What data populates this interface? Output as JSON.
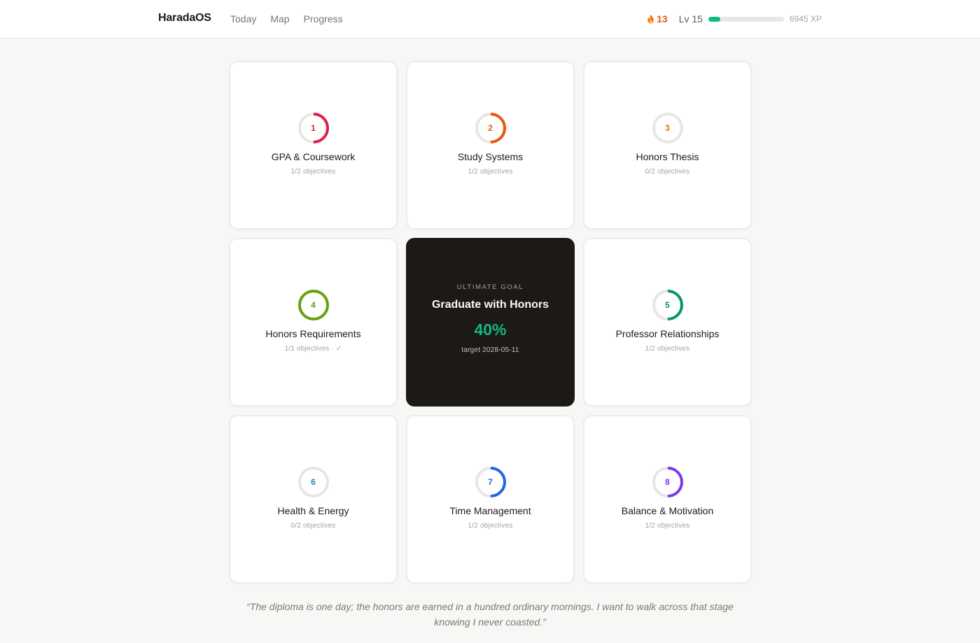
{
  "app": {
    "name": "HaradaOS"
  },
  "nav": [
    {
      "label": "Today"
    },
    {
      "label": "Map"
    },
    {
      "label": "Progress"
    }
  ],
  "stats": {
    "streak": "13",
    "level": "Lv 15",
    "xp_label": "6945 XP",
    "xp_progress": 0.16,
    "streak_color": "#ea580c",
    "xp_color": "#10b981"
  },
  "goal": {
    "eyebrow": "ULTIMATE GOAL",
    "title": "Graduate with Honors",
    "percent": "40%",
    "target": "target 2028-05-11"
  },
  "pillars": [
    {
      "num": "1",
      "title": "GPA & Coursework",
      "sub": "1/2 objectives",
      "progress": 0.5,
      "color": "#e11d48"
    },
    {
      "num": "2",
      "title": "Study Systems",
      "sub": "1/2 objectives",
      "progress": 0.5,
      "color": "#ea580c"
    },
    {
      "num": "3",
      "title": "Honors Thesis",
      "sub": "0/2 objectives",
      "progress": 0,
      "color": "#d97706"
    },
    {
      "num": "4",
      "title": "Honors Requirements",
      "sub": "1/1 objectives · ✓",
      "progress": 1,
      "color": "#65a30d"
    },
    {
      "num": "5",
      "title": "Professor Relationships",
      "sub": "1/2 objectives",
      "progress": 0.5,
      "color": "#059669"
    },
    {
      "num": "6",
      "title": "Health & Energy",
      "sub": "0/2 objectives",
      "progress": 0,
      "color": "#0891b2"
    },
    {
      "num": "7",
      "title": "Time Management",
      "sub": "1/2 objectives",
      "progress": 0.5,
      "color": "#2563eb"
    },
    {
      "num": "8",
      "title": "Balance & Motivation",
      "sub": "1/2 objectives",
      "progress": 0.5,
      "color": "#7c3aed"
    }
  ],
  "quote": "“The diploma is one day; the honors are earned in a hundred ordinary mornings. I want to walk across that stage knowing I never coasted.”"
}
